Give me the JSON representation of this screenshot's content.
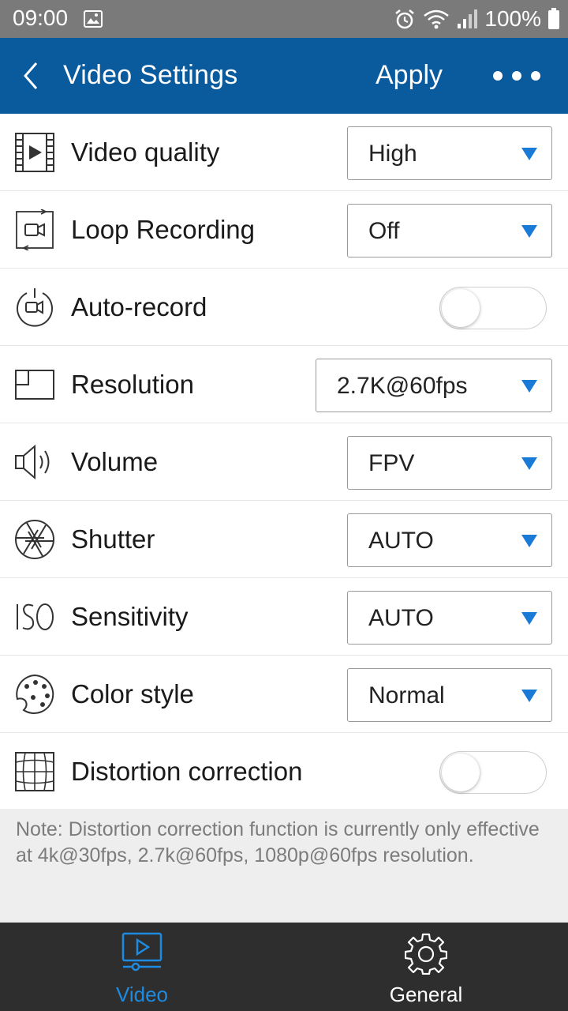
{
  "status_bar": {
    "time": "09:00",
    "battery": "100%"
  },
  "header": {
    "title": "Video Settings",
    "apply_label": "Apply"
  },
  "settings": [
    {
      "label": "Video quality",
      "control": "dropdown",
      "value": "High"
    },
    {
      "label": "Loop Recording",
      "control": "dropdown",
      "value": "Off"
    },
    {
      "label": "Auto-record",
      "control": "toggle",
      "value": "off"
    },
    {
      "label": "Resolution",
      "control": "dropdown",
      "value": "2.7K@60fps"
    },
    {
      "label": "Volume",
      "control": "dropdown",
      "value": "FPV"
    },
    {
      "label": "Shutter",
      "control": "dropdown",
      "value": "AUTO"
    },
    {
      "label": "Sensitivity",
      "control": "dropdown",
      "value": "AUTO"
    },
    {
      "label": "Color style",
      "control": "dropdown",
      "value": "Normal"
    },
    {
      "label": "Distortion correction",
      "control": "toggle",
      "value": "off"
    }
  ],
  "note": "Note: Distortion correction function is currently only effective at 4k@30fps, 2.7k@60fps, 1080p@60fps resolution.",
  "bottom_nav": [
    {
      "label": "Video",
      "icon": "video-tab-icon",
      "active": true
    },
    {
      "label": "General",
      "icon": "gear-icon",
      "active": false
    }
  ],
  "colors": {
    "header_bg": "#0a5a9e",
    "status_bar_bg": "#7a7a7a",
    "accent": "#1a7bd6",
    "bottom_nav_bg": "#2e2e2e",
    "active_tab": "#1e8be0"
  }
}
